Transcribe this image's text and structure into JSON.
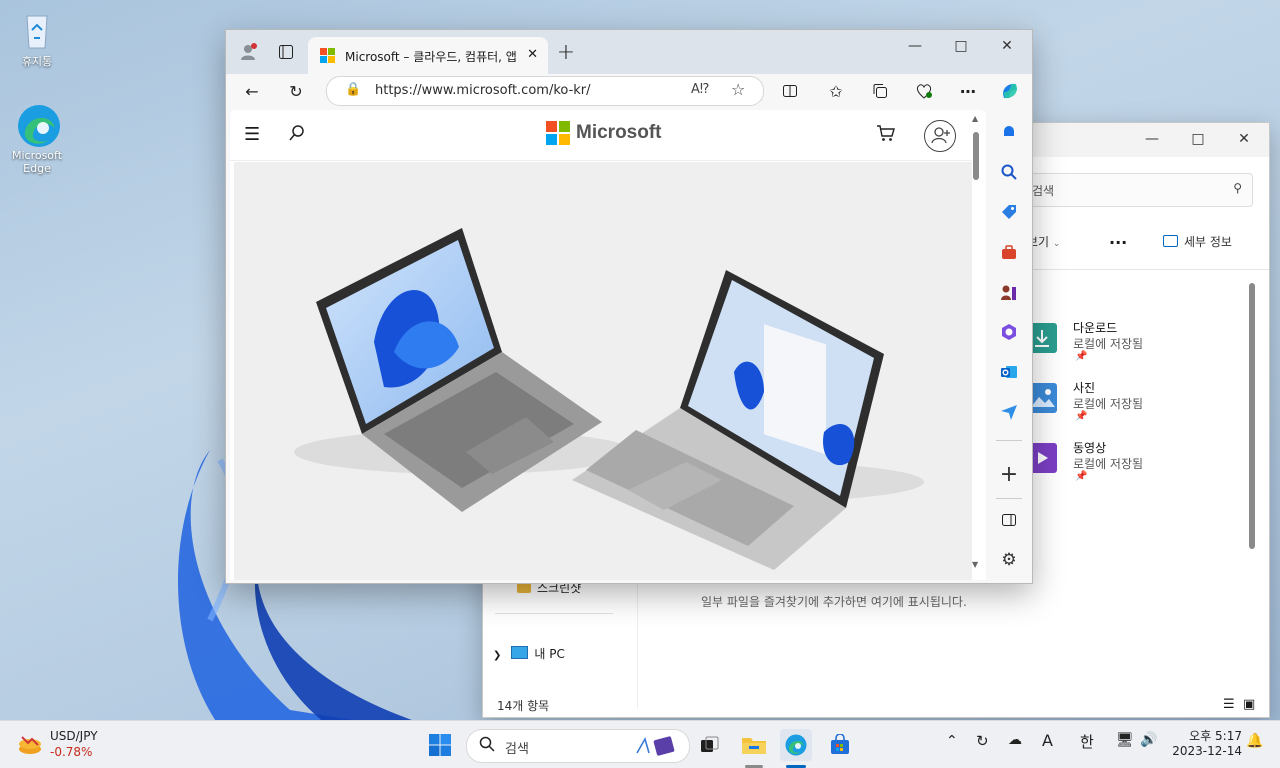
{
  "desktop": {
    "icons": [
      {
        "label": "휴지통"
      },
      {
        "label": "Microsoft Edge"
      }
    ]
  },
  "explorer": {
    "search_placeholder": "검색",
    "cmd_view": "보기",
    "cmd_more": "...",
    "cmd_details": "세부 정보",
    "quick_access": [
      {
        "name": "다운로드",
        "sub": "로컬에 저장됨",
        "color": "#2a9d8f"
      },
      {
        "name": "사진",
        "sub": "로컬에 저장됨",
        "color": "#3b8ad8"
      },
      {
        "name": "동영상",
        "sub": "로컬에 저장됨",
        "color": "#7b3fc4"
      }
    ],
    "nav": {
      "screenshots": "스크린샷",
      "this_pc": "내 PC"
    },
    "empty_message": "일부 파일을 즐겨찾기에 추가하면 여기에 표시됩니다.",
    "status": "14개 항목"
  },
  "edge": {
    "tab_title": "Microsoft – 클라우드, 컴퓨터, 앱",
    "url": "https://www.microsoft.com/ko-kr/",
    "site": {
      "logo_text": "Microsoft"
    }
  },
  "taskbar": {
    "widget_title": "USD/JPY",
    "widget_value": "-0.78%",
    "search_placeholder": "검색",
    "ime_a": "A",
    "ime_han": "한",
    "time": "오후 5:17",
    "date": "2023-12-14"
  },
  "colors": {
    "accent": "#0067c0",
    "negative": "#c42b1c"
  }
}
